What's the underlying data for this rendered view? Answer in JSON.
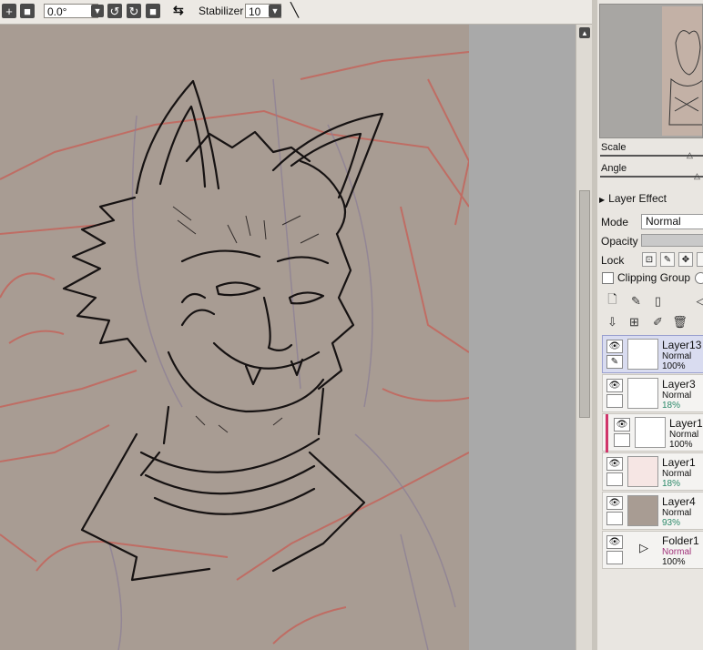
{
  "toolbar": {
    "rotation_value": "0.0°",
    "stabilizer_label": "Stabilizer",
    "stabilizer_value": "10"
  },
  "panel": {
    "scale_label": "Scale",
    "angle_label": "Angle",
    "layer_effect_label": "Layer Effect",
    "mode_label": "Mode",
    "mode_value": "Normal",
    "opacity_label": "Opacity",
    "lock_label": "Lock",
    "clipping_group_label": "Clipping Group"
  },
  "layers": [
    {
      "name": "Layer13",
      "mode": "Normal",
      "opacity": "100%",
      "selected": true
    },
    {
      "name": "Layer3",
      "mode": "Normal",
      "opacity": "18%",
      "selected": false
    },
    {
      "name": "Layer1",
      "mode": "Normal",
      "opacity": "100%",
      "selected": false
    },
    {
      "name": "Layer1",
      "mode": "Normal",
      "opacity": "18%",
      "selected": false
    },
    {
      "name": "Layer4",
      "mode": "Normal",
      "opacity": "93%",
      "selected": false
    },
    {
      "name": "Folder1",
      "mode": "Normal",
      "opacity": "100%",
      "selected": false
    }
  ],
  "colors": {
    "canvas_bg": "#a89c93",
    "sketch_red": "#c4655c",
    "ink": "#161212",
    "selected_layer": "#d9dcf0",
    "opacity_text": "#2c8a6a",
    "folder_mode": "#a0327a"
  }
}
